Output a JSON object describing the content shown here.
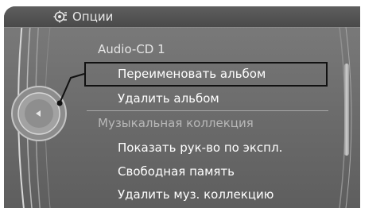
{
  "header": {
    "title": "Опции",
    "icon": "options-gear-icon"
  },
  "menu": {
    "section_audio_cd": "Audio-CD 1",
    "rename_album": "Переименовать альбом",
    "delete_album": "Удалить альбом",
    "section_music_collection": "Музыкальная коллекция",
    "show_manual": "Показать рук-во по экспл.",
    "free_memory": "Свободная память",
    "delete_music_collection": "Удалить муз. коллекцию"
  },
  "colors": {
    "background": "#6e6e6e",
    "header": "#4a4a4a",
    "text": "#ffffff",
    "selection_border": "#111111"
  }
}
